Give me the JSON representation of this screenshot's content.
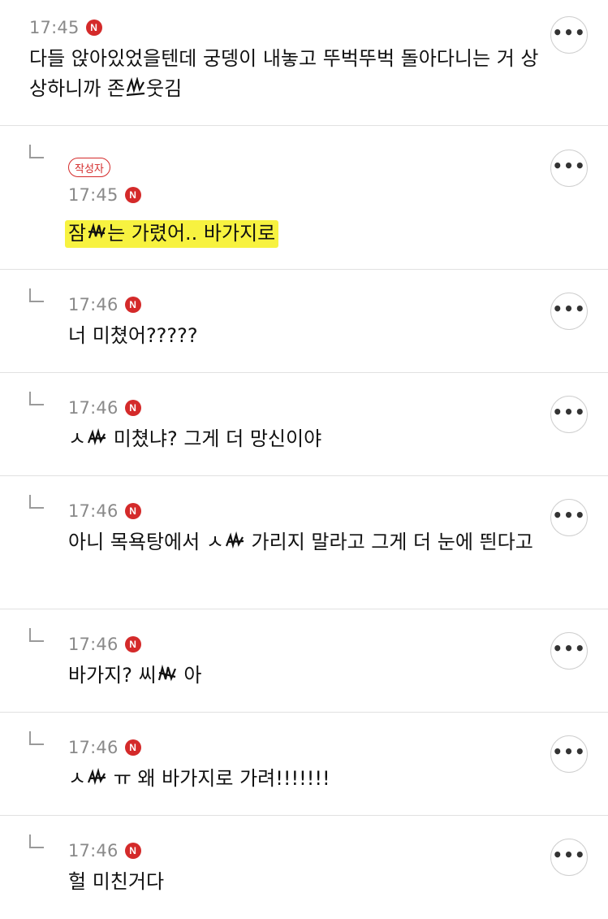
{
  "comments": [
    {
      "time": "17:45",
      "badge": "N",
      "text": "다들 앉아있었을텐데 궁뎅이 내놓고 뚜벅뚜벅 돌아다니는 거 상상하니까 존",
      "text_tail": "웃김",
      "more_icon": "ellipsis-icon"
    },
    {
      "time": "17:45",
      "badge": "N",
      "author_tag": "작성자",
      "text": "잠",
      "text_tail": "는 가렸어.. 바가지로",
      "highlight": "#f7f240"
    },
    {
      "time": "17:46",
      "badge": "N",
      "text": "너 미쳤어?????"
    },
    {
      "time": "17:46",
      "badge": "N",
      "text": "ㅅ",
      "text_tail": " 미쳤냐? 그게 더 망신이야"
    },
    {
      "time": "17:46",
      "badge": "N",
      "text": "아니 목욕탕에서 ㅅ",
      "text_tail": " 가리지 말라고 그게 더 눈에 띈다고"
    },
    {
      "time": "17:46",
      "badge": "N",
      "text": "바가지? 씨",
      "text_tail": " 아"
    },
    {
      "time": "17:46",
      "badge": "N",
      "text": "ㅅ",
      "text_tail": " ㅠ 왜 바가지로 가려!!!!!!!"
    },
    {
      "time": "17:46",
      "badge": "N",
      "text": "헐 미친거다"
    }
  ],
  "more_label": "•••",
  "colors": {
    "badge": "#d42a2a",
    "highlight": "#f7f240",
    "divider": "#e1e1e1",
    "time": "#8a8a8a"
  }
}
